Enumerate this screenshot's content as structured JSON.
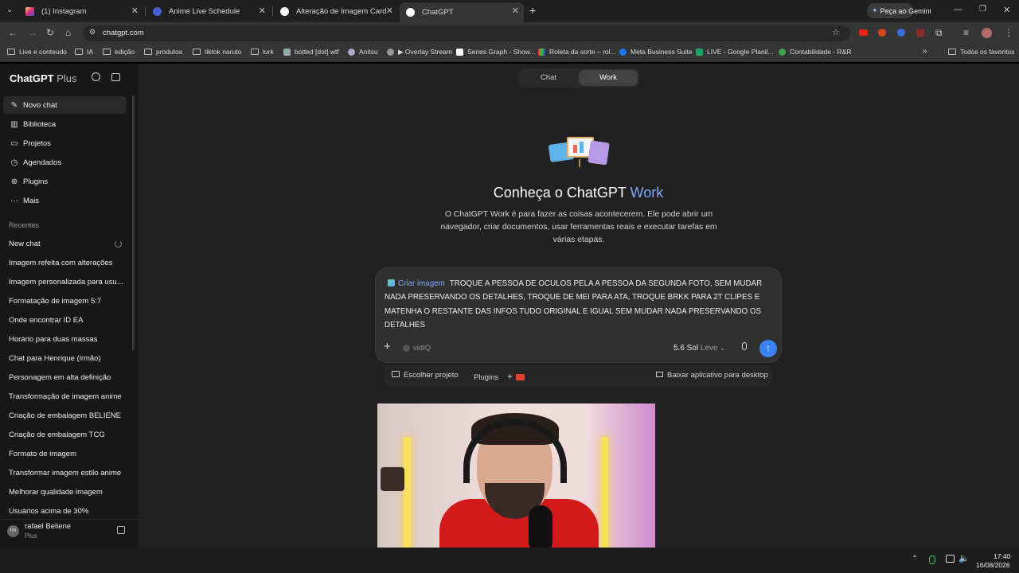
{
  "browser": {
    "tabs": [
      {
        "title": "(1) Instagram",
        "icon": "instagram-icon",
        "color": "#d6249f"
      },
      {
        "title": "Anime Live Schedule",
        "icon": "globe-icon",
        "color": "#5a6bd8"
      },
      {
        "title": "Alteração de Imagem Card",
        "icon": "chatgpt-icon",
        "color": "#ffffff"
      },
      {
        "title": "ChatGPT",
        "icon": "chatgpt-icon",
        "color": "#ffffff"
      }
    ],
    "gemini_button": "Peça ao Gemini",
    "url": "chatgpt.com",
    "bookmarks": [
      {
        "label": "Live e conteudo",
        "icon": "folder-icon"
      },
      {
        "label": "IA",
        "icon": "folder-icon"
      },
      {
        "label": "edição",
        "icon": "folder-icon"
      },
      {
        "label": "produtos",
        "icon": "folder-icon"
      },
      {
        "label": "tiktok naruto",
        "icon": "folder-icon"
      },
      {
        "label": "lurk",
        "icon": "folder-icon"
      },
      {
        "label": "botted [dot] wtf",
        "icon": "site-icon"
      },
      {
        "label": "Anitsu",
        "icon": "site-icon"
      },
      {
        "label": "▶ Overlay Stream",
        "icon": "site-icon"
      },
      {
        "label": "Series Graph - Show...",
        "icon": "site-icon"
      },
      {
        "label": "Roleta da sorte – rol...",
        "icon": "site-icon"
      },
      {
        "label": "Meta Business Suite",
        "icon": "meta-icon"
      },
      {
        "label": "LIVE - Google Planil...",
        "icon": "sheets-icon"
      },
      {
        "label": "Contabilidade - R&R",
        "icon": "site-icon"
      }
    ],
    "all_bookmarks": "Todos os favoritos"
  },
  "sidebar": {
    "brand": "ChatGPT",
    "plan": "Plus",
    "nav": [
      {
        "label": "Novo chat",
        "icon": "edit-icon"
      },
      {
        "label": "Biblioteca",
        "icon": "library-icon"
      },
      {
        "label": "Projetos",
        "icon": "folder-icon"
      },
      {
        "label": "Agendados",
        "icon": "clock-icon"
      },
      {
        "label": "Plugins",
        "icon": "plugins-icon"
      },
      {
        "label": "Mais",
        "icon": "more-icon"
      }
    ],
    "recents_label": "Recentes",
    "recents": [
      "New chat",
      "Imagem refeita com alterações",
      "Imagem personalizada para usu...",
      "Formatação de imagem 5:7",
      "Onde encontrar ID EA",
      "Horário para duas massas",
      "Chat para Henrique (irmão)",
      "Personagem em alta definição",
      "Transformação de imagem anime",
      "Criação de embalagem BELIENE",
      "Criação de embalagem TCG",
      "Formato de imagem",
      "Transformar imagem estilo anime",
      "Melhorar qualidade imagem",
      "Usuários acima de 30%"
    ],
    "user": {
      "name": "rafael Beliene",
      "plan": "Plus",
      "initials": "RB"
    }
  },
  "main": {
    "mode_tabs": [
      "Chat",
      "Work"
    ],
    "active_mode": "Work",
    "heading_prefix": "Conheça o ChatGPT",
    "heading_accent": "Work",
    "description": "O ChatGPT Work é para fazer as coisas acontecerem. Ele pode abrir um navegador, criar documentos, usar ferramentas reais e executar tarefas em várias etapas.",
    "composer": {
      "tag": "Criar imagem",
      "text": "TROQUE A PESSOA DE OCULOS PELA A PESSOA DA SEGUNDA FOTO, SEM MUDAR NADA PRESERVANDO OS DETALHES, TROQUE DE MEI PARA ATA, TROQUE BRKK PARA 2T CLIPES E MATENHA O RESTANTE DAS INFOS TUDO ORIGINAL E IGUAL SEM MUDAR NADA PRESERVANDO OS DETALHES",
      "tool": "vidIQ",
      "model": "5.6 Sol",
      "effort": "Leve"
    },
    "footer": {
      "project": "Escolher projeto",
      "plugins": "Plugins",
      "download": "Baixar aplicativo para desktop"
    }
  },
  "taskbar": {
    "time": "17:40",
    "date": "16/08/2026"
  },
  "colors": {
    "accent": "#7ea8ff",
    "send": "#3b82f6",
    "sidebar": "#171717",
    "main": "#212121"
  }
}
